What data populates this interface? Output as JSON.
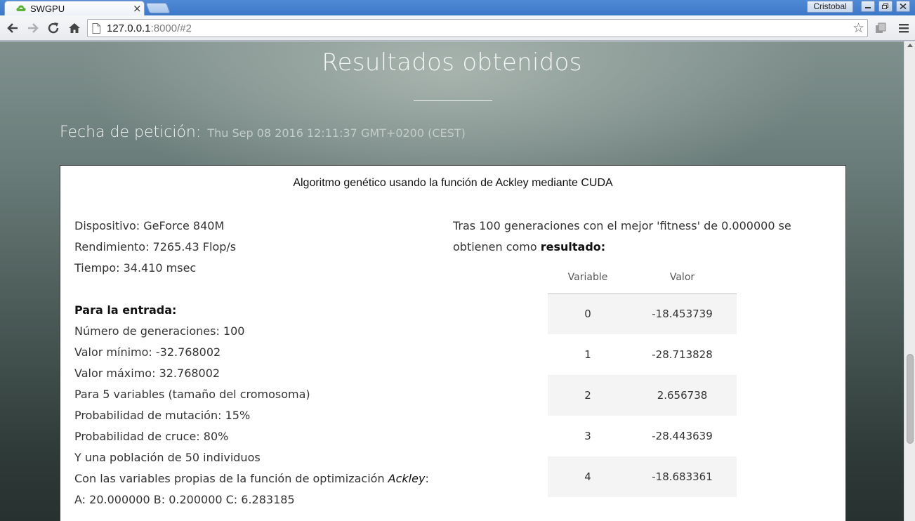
{
  "browser": {
    "tab_title": "SWGPU",
    "tab_close": "×",
    "user_name": "Cristobal",
    "url_host": "127.0.0.1",
    "url_rest": ":8000/#2",
    "star": "☆"
  },
  "page": {
    "title": "Resultados obtenidos",
    "request_label": "Fecha de petición:",
    "request_date": "Thu Sep 08 2016 12:11:37 GMT+0200 (CEST)"
  },
  "card": {
    "title": "Algoritmo genético usando la función de Ackley mediante CUDA",
    "device": "Dispositivo: GeForce 840M",
    "performance": "Rendimiento: 7265.43 Flop/s",
    "time": "Tiempo: 34.410 msec",
    "input_heading": "Para la entrada:",
    "generations": "Número de generaciones: 100",
    "min_value": "Valor mínimo: -32.768002",
    "max_value": "Valor máximo: 32.768002",
    "variables": "Para 5 variables (tamaño del cromosoma)",
    "mutation": "Probabilidad de mutación: 15%",
    "crossover": "Probabilidad de cruce: 80%",
    "population": "Y una población de 50 individuos",
    "ackley_prefix": "Con las variables propias de la función de optimización ",
    "ackley_name": "Ackley",
    "ackley_suffix": ":",
    "params": "A: 20.000000 B: 0.200000 C: 6.283185",
    "summary_text": "Tras 100 generaciones con el mejor 'fitness' de 0.000000 se obtienen como ",
    "summary_bold": "resultado:"
  },
  "results_table": {
    "headers": [
      "Variable",
      "Valor"
    ],
    "rows": [
      [
        "0",
        "-18.453739"
      ],
      [
        "1",
        "-28.713828"
      ],
      [
        "2",
        "2.656738"
      ],
      [
        "3",
        "-28.443639"
      ],
      [
        "4",
        "-18.683361"
      ]
    ]
  }
}
